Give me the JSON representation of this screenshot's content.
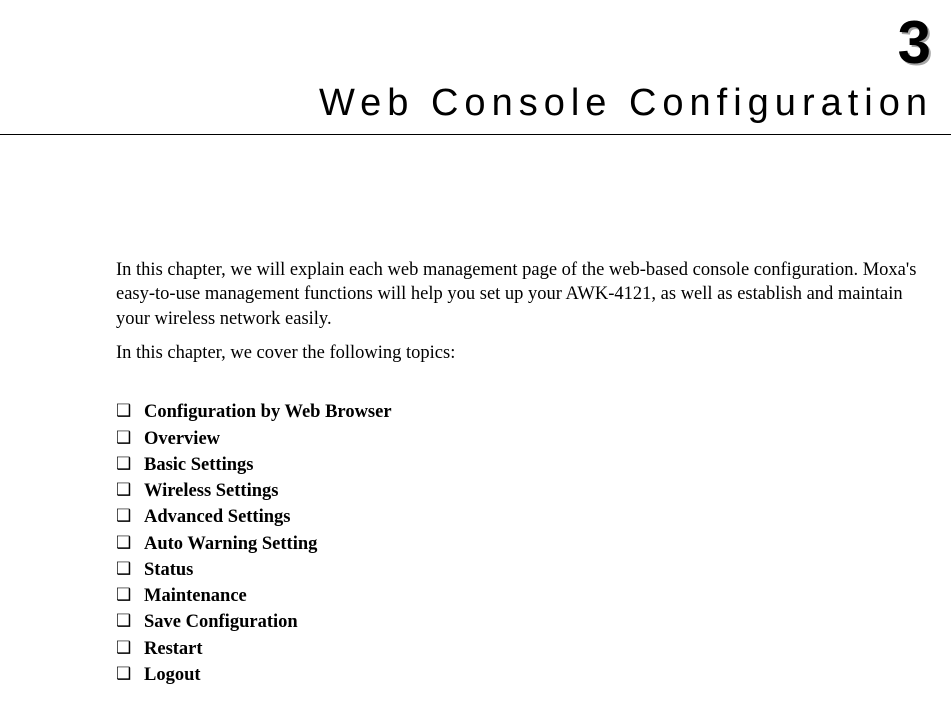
{
  "chapter": {
    "number": "3",
    "title": "Web Console Configuration"
  },
  "intro": {
    "paragraph": "In this chapter, we will explain each web management page of the web-based console configuration. Moxa's easy-to-use management functions will help you set up your AWK-4121, as well as establish and maintain your wireless network easily.",
    "topics_lead": "In this chapter, we cover the following topics:"
  },
  "topics": [
    "Configuration by Web Browser",
    "Overview",
    "Basic Settings",
    "Wireless Settings",
    "Advanced Settings",
    "Auto Warning Setting",
    "Status",
    "Maintenance",
    "Save Configuration",
    "Restart",
    "Logout"
  ]
}
